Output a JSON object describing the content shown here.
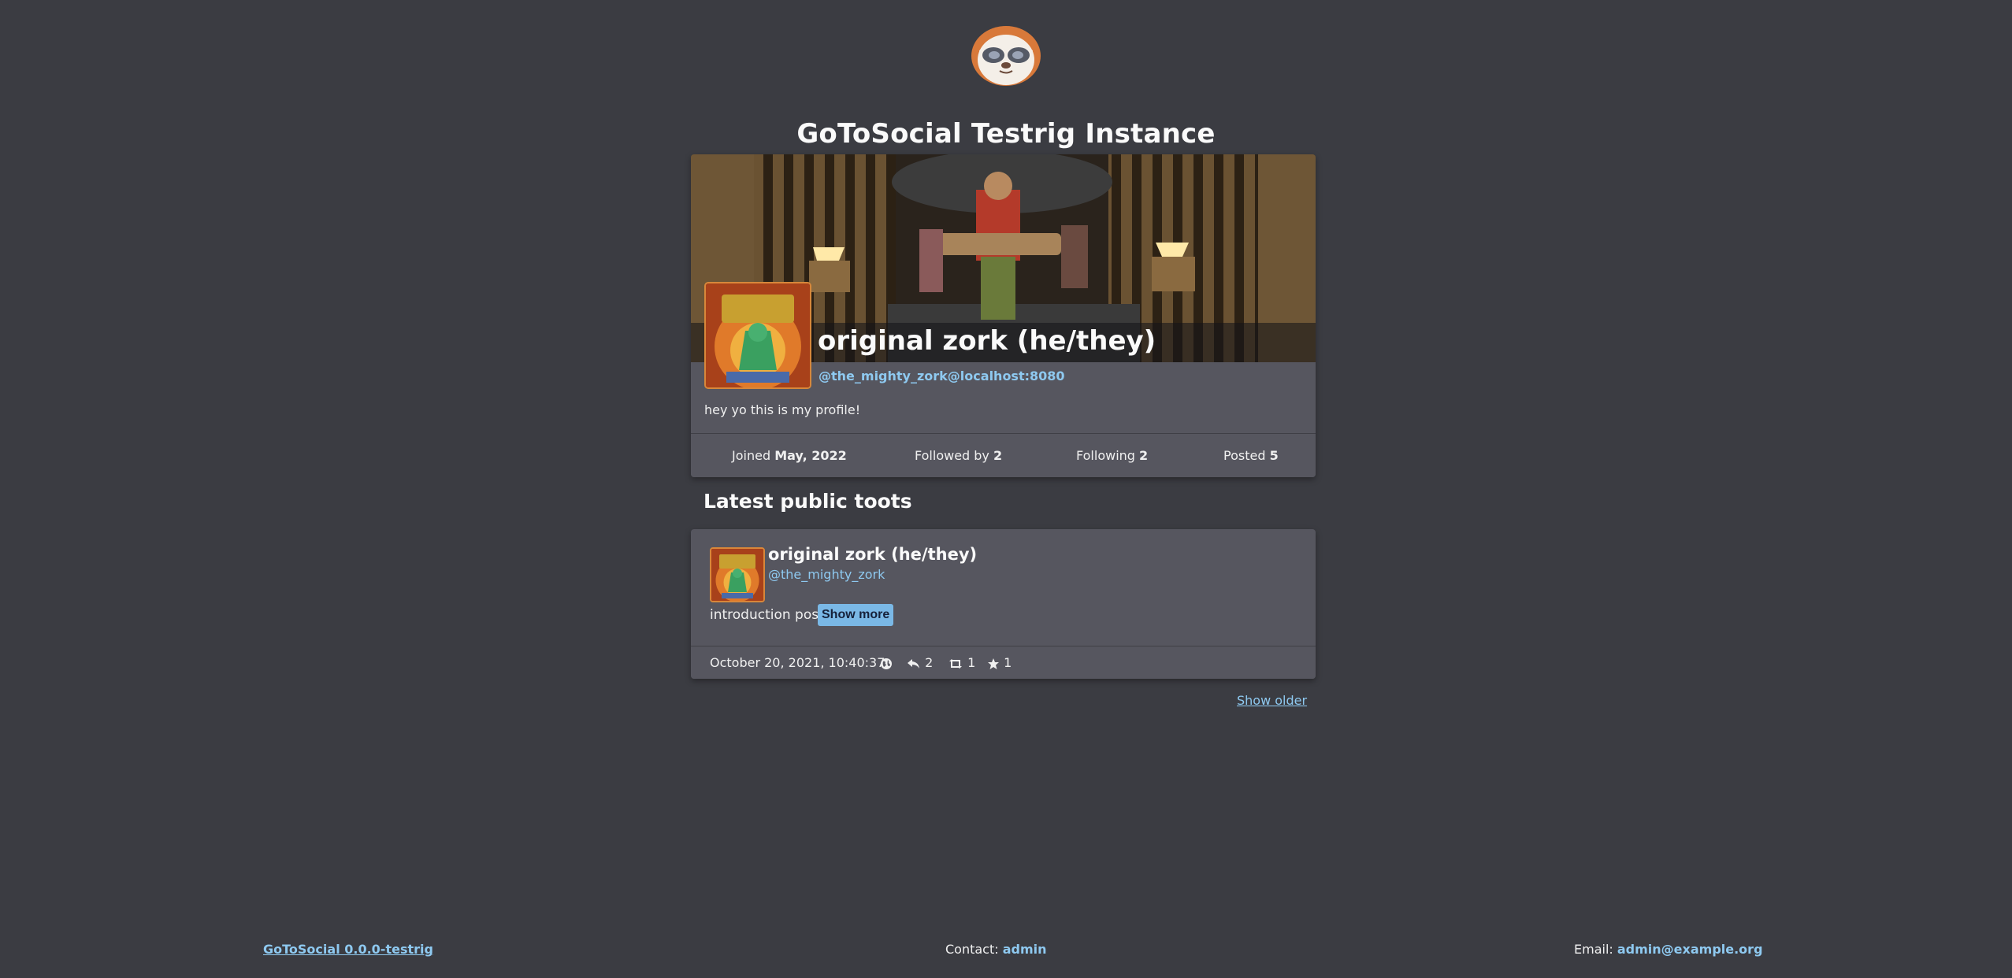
{
  "site": {
    "title": "GoToSocial Testrig Instance",
    "logo_icon": "sloth-logo-icon"
  },
  "profile": {
    "display_name": "original zork (he/they)",
    "handle": "@the_mighty_zork@localhost:8080",
    "bio": "hey yo this is my profile!",
    "stats": {
      "joined_label": "Joined",
      "joined_value": "May, 2022",
      "followed_label": "Followed by",
      "followed_value": "2",
      "following_label": "Following",
      "following_value": "2",
      "posted_label": "Posted",
      "posted_value": "5"
    }
  },
  "latest": {
    "title": "Latest public toots",
    "toots": [
      {
        "display_name": "original zork (he/they)",
        "handle": "@the_mighty_zork",
        "content": "introduction post",
        "show_more": "Show more",
        "date": "October 20, 2021, 10:40:37",
        "visibility_icon": "globe-icon",
        "replies": "2",
        "boosts": "1",
        "faves": "1"
      }
    ],
    "show_older": "Show older"
  },
  "footer": {
    "version": "GoToSocial 0.0.0-testrig",
    "contact_label": "Contact:",
    "contact_value": "admin",
    "email_label": "Email:",
    "email_value": "admin@example.org"
  },
  "colors": {
    "background": "#3b3c42",
    "card": "#56565f",
    "link": "#8ec9f0",
    "button": "#7ab8e6",
    "accent_orange": "#d8873a"
  }
}
